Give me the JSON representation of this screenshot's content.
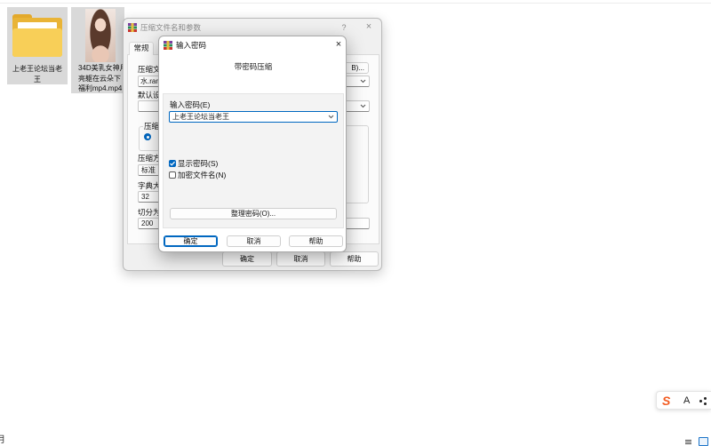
{
  "desktop": {
    "folder": {
      "label_line1": "上老王论坛当老",
      "label_line2": "王",
      "icon": "folder-icon"
    },
    "video": {
      "label_line1": "34D美乳女神月",
      "label_line2": "亮躯在云朵下",
      "label_line3": "福利mp4.mp4",
      "icon": "video-thumbnail"
    }
  },
  "archive_dialog": {
    "title": "压缩文件名和参数",
    "help_glyph": "?",
    "close_glyph": "×",
    "tabs": [
      {
        "label": "常规"
      }
    ],
    "archive_name_label": "压缩文",
    "browse_label": "B)...",
    "archive_name_value": "水.rar",
    "profile_label": "默认设",
    "format_group_label": "压缩文",
    "method_label": "压缩方",
    "method_value": "标准",
    "dictionary_label": "字典大",
    "dictionary_value": "32",
    "split_label": "切分为",
    "split_value": "200",
    "buttons": {
      "ok": "确定",
      "cancel": "取消",
      "help": "帮助"
    }
  },
  "password_dialog": {
    "title": "输入密码",
    "close_glyph": "×",
    "header": "带密码压缩",
    "password_label": "输入密码(E)",
    "password_value": "上老王论坛当老王",
    "show_password": {
      "label": "显示密码(S)",
      "checked": true
    },
    "encrypt_filenames": {
      "label": "加密文件名(N)",
      "checked": false
    },
    "organize_button": "整理密码(O)...",
    "buttons": {
      "ok": "确定",
      "cancel": "取消",
      "help": "帮助"
    }
  },
  "ime_toolbar": {
    "logo_text": "S",
    "mode_label": "A",
    "menu_icon": "dots-icon"
  },
  "taskbar": {
    "left_glyph": "月",
    "right_icons": [
      "menu-lines-icon",
      "window-square-icon"
    ]
  },
  "colors": {
    "accent": "#0067c0",
    "sogou_orange": "#f25a1f",
    "folder_yellow": "#f8cf58",
    "selection": "#d9d9d9"
  }
}
